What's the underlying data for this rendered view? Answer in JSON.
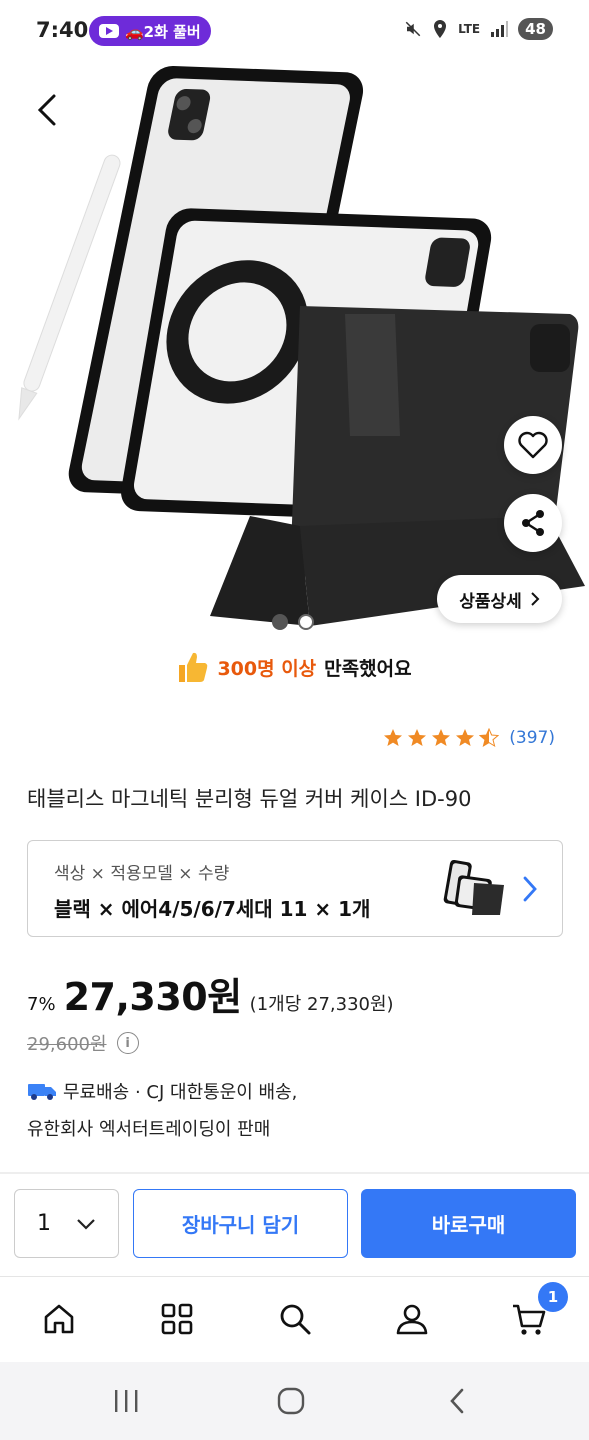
{
  "status_bar": {
    "time": "7:40",
    "notification_text": "🚗2화 풀버",
    "battery": "48",
    "network": "LTE"
  },
  "product": {
    "detail_button": "상품상세",
    "satisfaction_count": "300명 이상",
    "satisfaction_text": "만족했어요",
    "rating": 4.5,
    "review_count": "(397)",
    "title": "태블리스 마그네틱 분리형 듀얼 커버 케이스 ID-90",
    "option_label": "색상 × 적용모델 × 수량",
    "option_value": "블랙 × 에어4/5/6/7세대 11 × 1개",
    "discount": "7%",
    "price": "27,330원",
    "unit_price": "(1개당 27,330원)",
    "original_price": "29,600원",
    "info_symbol": "i",
    "shipping": "무료배송 · CJ 대한통운이 배송,",
    "seller": "유한회사 엑서터트레이딩이 판매"
  },
  "buy_bar": {
    "quantity": "1",
    "cart_label": "장바구니 담기",
    "buy_label": "바로구매"
  },
  "tab_bar": {
    "items": [
      "home-icon",
      "category-icon",
      "search-icon",
      "user-icon",
      "cart-icon"
    ],
    "cart_badge": "1"
  },
  "colors": {
    "accent": "#3478f6",
    "satisfaction": "#e8590c",
    "star": "#f08a24",
    "notification_pill": "#6e2bd9"
  }
}
